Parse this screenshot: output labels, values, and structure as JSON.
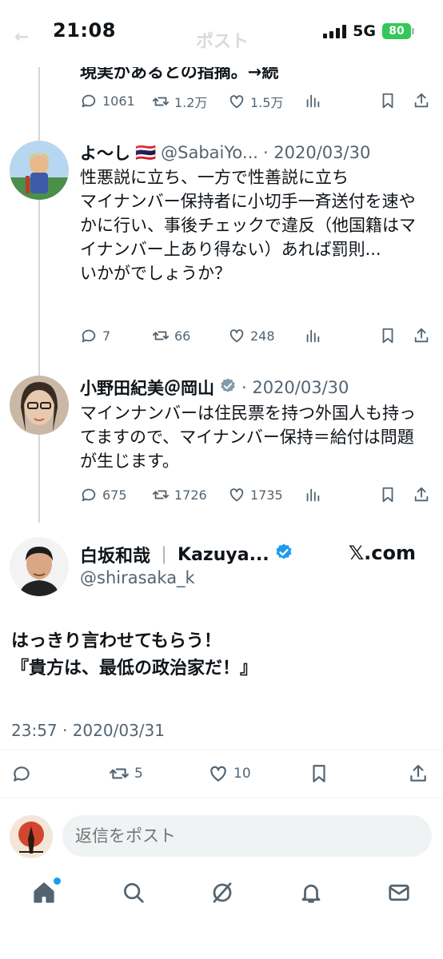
{
  "status_bar": {
    "time": "21:08",
    "network": "5G",
    "battery": "80"
  },
  "header": {
    "title": "ポスト",
    "back": "←"
  },
  "thread_top": {
    "cut_text": "現実があるとの指摘。→続",
    "actions": {
      "replies": "1061",
      "reposts": "1.2万",
      "likes": "1.5万"
    }
  },
  "reply1": {
    "name": "よ〜し",
    "flag": "🇹🇭",
    "handle": "@SabaiYo...",
    "date": "· 2020/03/30",
    "more": "···",
    "body": "性悪説に立ち、一方で性善説に立ち\nマイナンバー保持者に小切手一斉送付を速やかに行い、事後チェックで違反（他国籍はマイナンバー上あり得ない）あれば罰則...\nいかがでしょうか？",
    "actions": {
      "replies": "7",
      "reposts": "66",
      "likes": "248"
    }
  },
  "reply2": {
    "name": "小野田紀美＠岡山",
    "date": "· 2020/03/30",
    "body": "マインナンバーは住民票を持つ外国人も持ってますので、マイナンバー保持＝給付は問題が生じます。",
    "actions": {
      "replies": "675",
      "reposts": "1726",
      "likes": "1735"
    }
  },
  "main_tweet": {
    "name": "白坂和哉",
    "separator": "｜",
    "name_en": "Kazuya...",
    "handle": "@shirasaka_k",
    "source": "𝕏.com",
    "body": "はっきり言わせてもらう！\n『貴方は、最低の政治家だ！』",
    "timestamp": "23:57 · 2020/03/31",
    "actions": {
      "reposts": "5",
      "likes": "10"
    }
  },
  "compose": {
    "placeholder": "返信をポスト"
  },
  "colors": {
    "accent": "#1d9bf0",
    "text": "#0f1419",
    "secondary": "#536471",
    "verified": "#1d9bf0",
    "verified_gray": "#829aab"
  }
}
